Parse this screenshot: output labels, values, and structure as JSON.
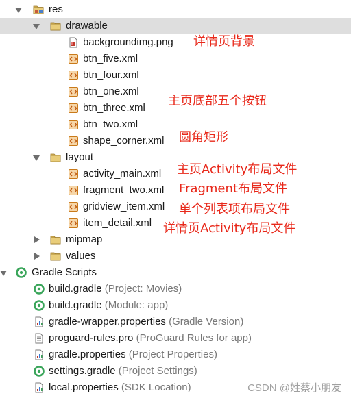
{
  "tree": {
    "res": "res",
    "drawable": "drawable",
    "drawable_files": [
      "backgroundimg.png",
      "btn_five.xml",
      "btn_four.xml",
      "btn_one.xml",
      "btn_three.xml",
      "btn_two.xml",
      "shape_corner.xml"
    ],
    "layout": "layout",
    "layout_files": [
      "activity_main.xml",
      "fragment_two.xml",
      "gridview_item.xml",
      "item_detail.xml"
    ],
    "mipmap": "mipmap",
    "values": "values",
    "gradle_scripts": "Gradle Scripts",
    "scripts": [
      {
        "name": "build.gradle",
        "detail": "(Project: Movies)"
      },
      {
        "name": "build.gradle",
        "detail": "(Module: app)"
      },
      {
        "name": "gradle-wrapper.properties",
        "detail": "(Gradle Version)"
      },
      {
        "name": "proguard-rules.pro",
        "detail": "(ProGuard Rules for app)"
      },
      {
        "name": "gradle.properties",
        "detail": "(Project Properties)"
      },
      {
        "name": "settings.gradle",
        "detail": "(Project Settings)"
      },
      {
        "name": "local.properties",
        "detail": "(SDK Location)"
      }
    ]
  },
  "annotations": {
    "detail_bg": "详情页背景",
    "bottom_buttons": "主页底部五个按钮",
    "rounded_rect": "圆角矩形",
    "main_layout": "主页Activity布局文件",
    "fragment_layout": "Fragment布局文件",
    "item_layout": "单个列表项布局文件",
    "detail_layout": "详情页Activity布局文件"
  },
  "watermark": "CSDN @姓蔡小朋友",
  "colors": {
    "folder": "#c9a44d",
    "selection": "#dedede",
    "annotation": "#e8281a",
    "gradle": "#3aa55a",
    "xml_icon": "#e08b2a"
  }
}
